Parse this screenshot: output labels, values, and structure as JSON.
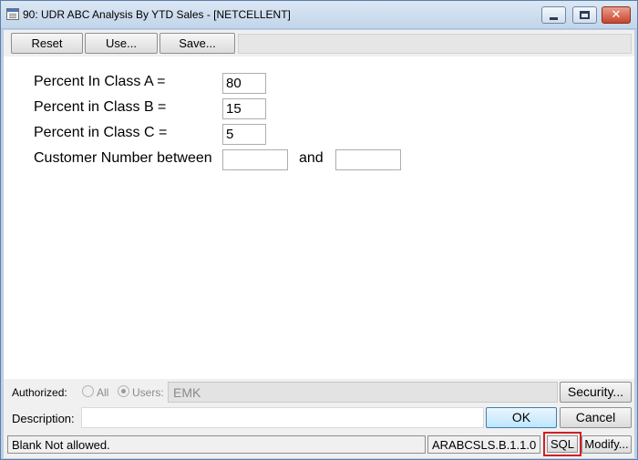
{
  "window": {
    "title": "90:  UDR ABC Analysis By YTD Sales - [NETCELLENT]",
    "minimize_icon": "minimize-icon",
    "maximize_icon": "maximize-icon",
    "close_icon": "close-icon",
    "close_glyph": "✕"
  },
  "toolbar": {
    "reset_label": "Reset",
    "use_label": "Use...",
    "save_label": "Save..."
  },
  "form": {
    "class_a_label": "Percent In Class A =",
    "class_a_value": "80",
    "class_b_label": "Percent in Class B =",
    "class_b_value": "15",
    "class_c_label": "Percent in Class C =",
    "class_c_value": "5",
    "customer_label": "Customer Number between",
    "customer_from_value": "",
    "and_label": "and",
    "customer_to_value": ""
  },
  "footer": {
    "authorized_label": "Authorized:",
    "radio_all_label": "All",
    "radio_all_checked": false,
    "radio_users_label": "Users:",
    "radio_users_checked": true,
    "users_value": "EMK",
    "security_label": "Security...",
    "description_label": "Description:",
    "description_value": "",
    "ok_label": "OK",
    "cancel_label": "Cancel"
  },
  "status": {
    "message": "Blank Not allowed.",
    "report_code": "ARABCSLS.B.1.1.0",
    "sql_label": "SQL",
    "modify_label": "Modify..."
  },
  "colors": {
    "highlight_border": "#d21f26",
    "title_bar": "#c2d5ea",
    "client_bg": "#f0f0f0"
  }
}
